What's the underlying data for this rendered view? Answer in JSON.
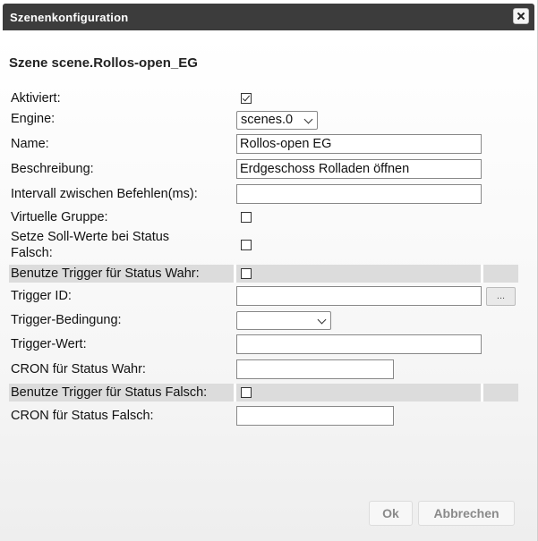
{
  "dialog": {
    "title": "Szenenkonfiguration",
    "close_icon": "close-icon"
  },
  "scene_title": "Szene scene.Rollos-open_EG",
  "fields": {
    "aktiviert": {
      "label": "Aktiviert:",
      "checked": true
    },
    "engine": {
      "label": "Engine:",
      "value": "scenes.0"
    },
    "name": {
      "label": "Name:",
      "value": "Rollos-open EG"
    },
    "beschreibung": {
      "label": "Beschreibung:",
      "value": "Erdgeschoss Rolladen öffnen"
    },
    "intervall": {
      "label": "Intervall zwischen Befehlen(ms):",
      "value": ""
    },
    "virtuelle_gruppe": {
      "label": "Virtuelle Gruppe:",
      "checked": false
    },
    "setze_soll": {
      "label_line1": "Setze Soll-Werte bei Status",
      "label_line2": "Falsch:",
      "checked": false
    },
    "trigger_wahr": {
      "label": "Benutze Trigger für Status Wahr:",
      "checked": false
    },
    "trigger_id": {
      "label": "Trigger ID:",
      "value": "",
      "button": "..."
    },
    "trigger_bedingung": {
      "label": "Trigger-Bedingung:",
      "value": ""
    },
    "trigger_wert": {
      "label": "Trigger-Wert:",
      "value": ""
    },
    "cron_wahr": {
      "label": "CRON für Status Wahr:",
      "value": ""
    },
    "trigger_falsch": {
      "label": "Benutze Trigger für Status Falsch:",
      "checked": false
    },
    "cron_falsch": {
      "label": "CRON für Status Falsch:",
      "value": ""
    }
  },
  "buttons": {
    "ok": "Ok",
    "cancel": "Abbrechen"
  }
}
